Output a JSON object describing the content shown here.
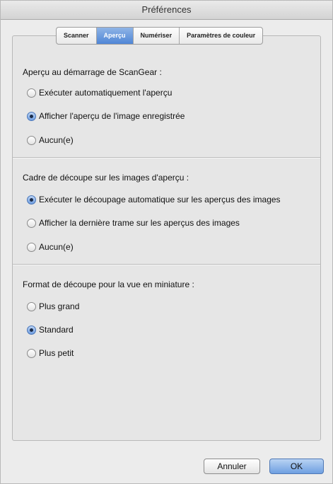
{
  "window": {
    "title": "Préférences"
  },
  "tabs": [
    {
      "label": "Scanner",
      "active": false
    },
    {
      "label": "Aperçu",
      "active": true
    },
    {
      "label": "Numériser",
      "active": false
    },
    {
      "label": "Paramètres de couleur",
      "active": false
    }
  ],
  "sections": [
    {
      "title": "Aperçu au démarrage de ScanGear :",
      "options": [
        {
          "label": "Exécuter automatiquement l'aperçu",
          "checked": false
        },
        {
          "label": "Afficher l'aperçu de l'image enregistrée",
          "checked": true
        },
        {
          "label": "Aucun(e)",
          "checked": false
        }
      ]
    },
    {
      "title": "Cadre de découpe sur les images d'aperçu :",
      "options": [
        {
          "label": "Exécuter le découpage automatique sur les aperçus des images",
          "checked": true
        },
        {
          "label": "Afficher la dernière trame sur les aperçus des images",
          "checked": false
        },
        {
          "label": "Aucun(e)",
          "checked": false
        }
      ]
    },
    {
      "title": "Format de découpe pour la vue en miniature :",
      "options": [
        {
          "label": "Plus grand",
          "checked": false
        },
        {
          "label": "Standard",
          "checked": true
        },
        {
          "label": "Plus petit",
          "checked": false
        }
      ]
    }
  ],
  "buttons": {
    "cancel": "Annuler",
    "ok": "OK"
  },
  "colors": {
    "accent": "#6e9fe1",
    "tab_active": "#4f86d6"
  }
}
